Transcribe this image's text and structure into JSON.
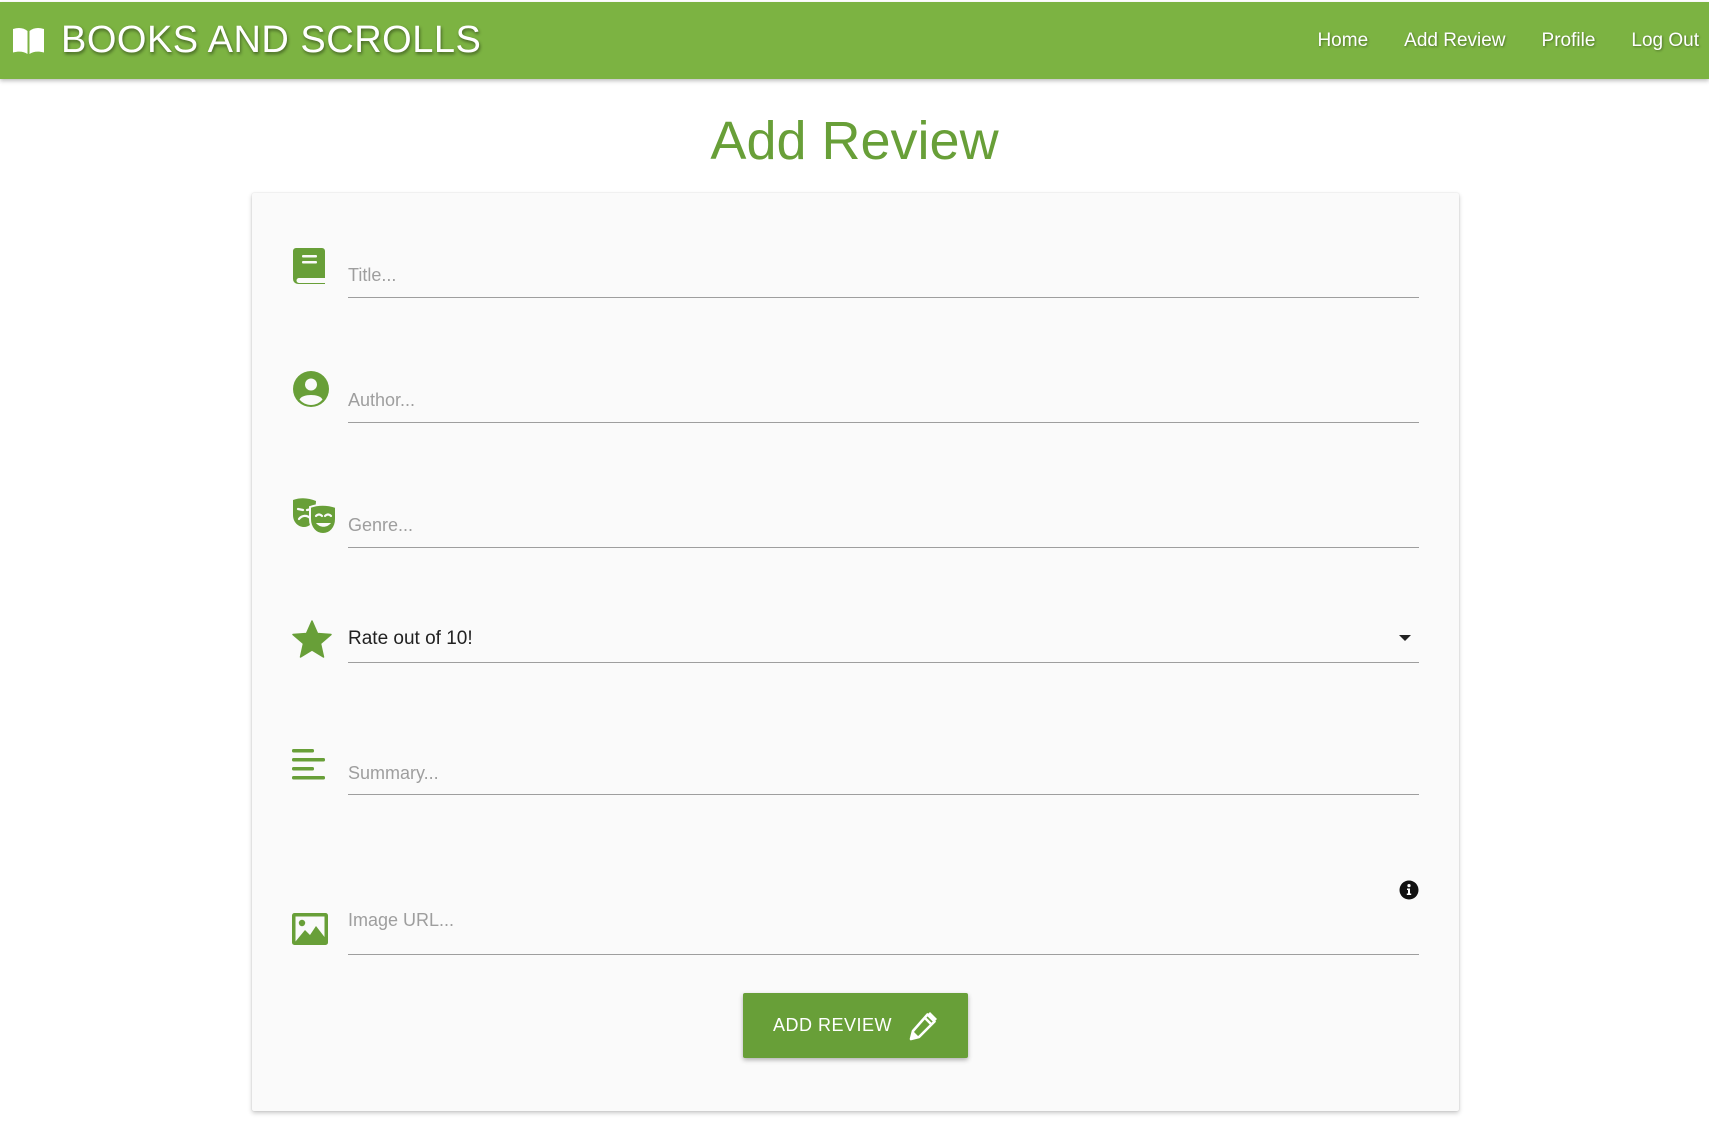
{
  "navbar": {
    "brand": "BOOKS AND SCROLLS",
    "links": [
      "Home",
      "Add Review",
      "Profile",
      "Log Out"
    ]
  },
  "page": {
    "title": "Add Review"
  },
  "form": {
    "title_placeholder": "Title...",
    "author_placeholder": "Author...",
    "genre_placeholder": "Genre...",
    "rating_selected": "Rate out of 10!",
    "summary_placeholder": "Summary...",
    "image_placeholder": "Image URL...",
    "submit_label": "ADD REVIEW"
  },
  "colors": {
    "navbar": "#7cb342",
    "accent": "#689f38",
    "card_bg": "#fafafa"
  },
  "icons": {
    "brand": "open-book-icon",
    "title": "book-icon",
    "author": "account-circle-icon",
    "genre": "theater-masks-icon",
    "rating": "star-icon",
    "summary": "align-left-icon",
    "image": "image-icon",
    "info": "info-circle-icon",
    "submit": "pencil-icon"
  }
}
